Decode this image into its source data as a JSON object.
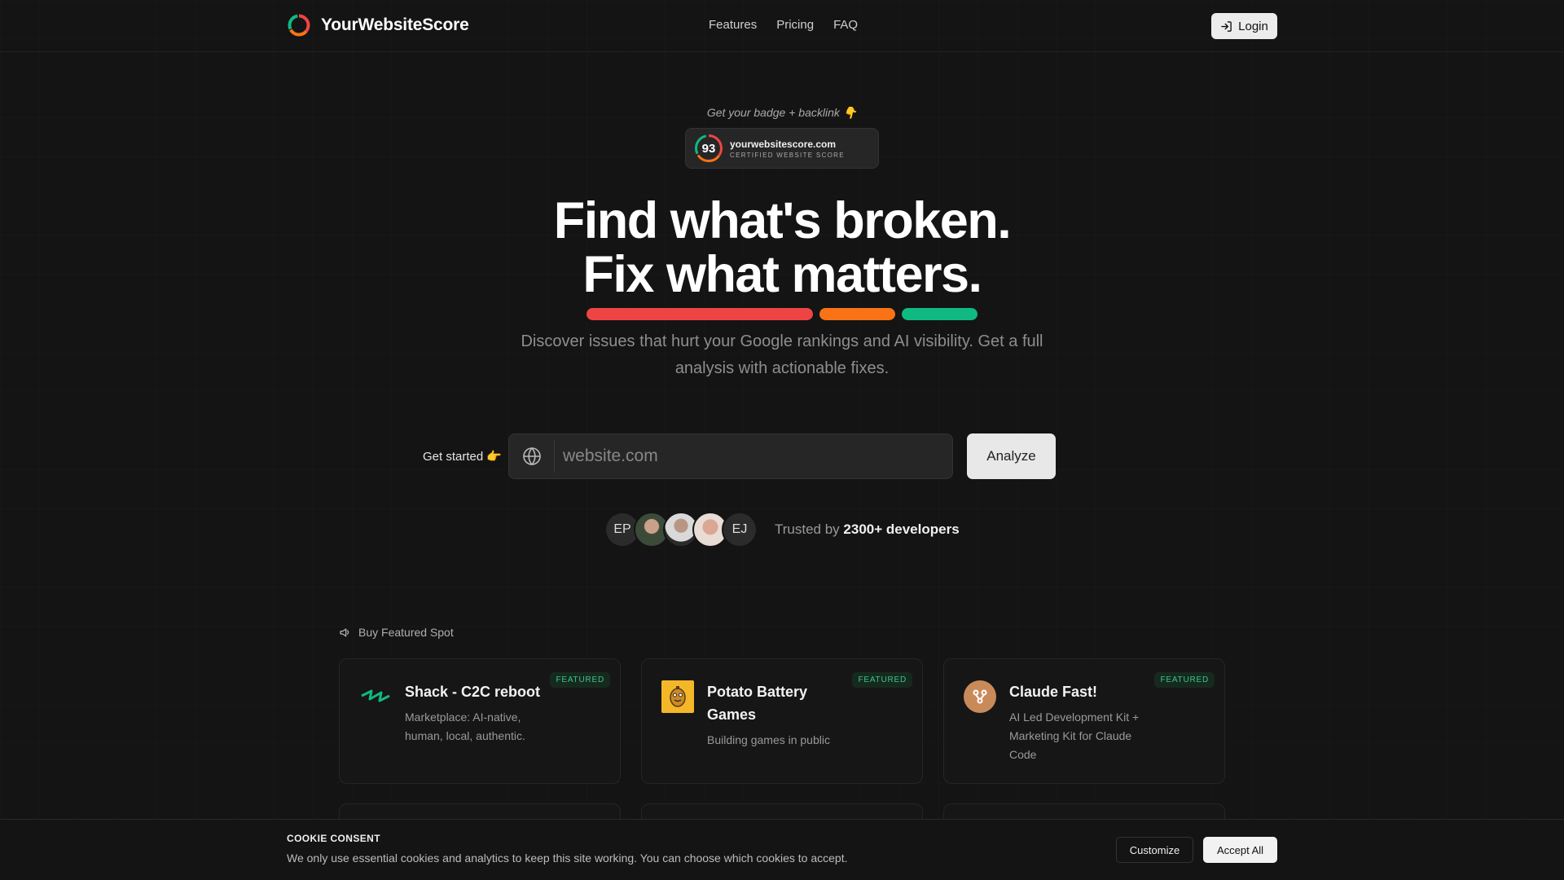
{
  "header": {
    "logo_text": "YourWebsiteScore",
    "nav": [
      "Features",
      "Pricing",
      "FAQ"
    ],
    "login_label": "Login"
  },
  "hero": {
    "badge_caption": "Get your badge + backlink 👇",
    "badge": {
      "score": "93",
      "domain": "yourwebsitescore.com",
      "subtitle": "CERTIFIED WEBSITE SCORE"
    },
    "title_line1": "Find what's broken.",
    "title_line2": "Fix what matters.",
    "subtitle": "Discover issues that hurt your Google rankings and AI visibility. Get a full analysis with actionable fixes.",
    "get_started": "Get started 👉",
    "search_placeholder": "website.com",
    "analyze_label": "Analyze",
    "avatars": [
      "EP",
      "",
      "",
      "",
      "EJ"
    ],
    "trusted_prefix": "Trusted by",
    "trusted_count": "2300+ developers"
  },
  "featured": {
    "title": "Buy Featured Spot",
    "badge_label": "FEATURED",
    "cards": [
      {
        "name": "Shack - C2C reboot",
        "desc": "Marketplace: AI-native, human, local, authentic."
      },
      {
        "name": "Potato Battery Games",
        "desc": "Building games in public"
      },
      {
        "name": "Claude Fast!",
        "desc": "AI Led Development Kit + Marketing Kit for Claude Code"
      }
    ]
  },
  "cookie": {
    "title": "COOKIE CONSENT",
    "text": "We only use essential cookies and analytics to keep this site working. You can choose which cookies to accept.",
    "customize_label": "Customize",
    "accept_label": "Accept All"
  },
  "colors": {
    "bar_red": "#ef4444",
    "bar_orange": "#f97316",
    "bar_green": "#10b981",
    "featured_green": "#3ec58b"
  }
}
